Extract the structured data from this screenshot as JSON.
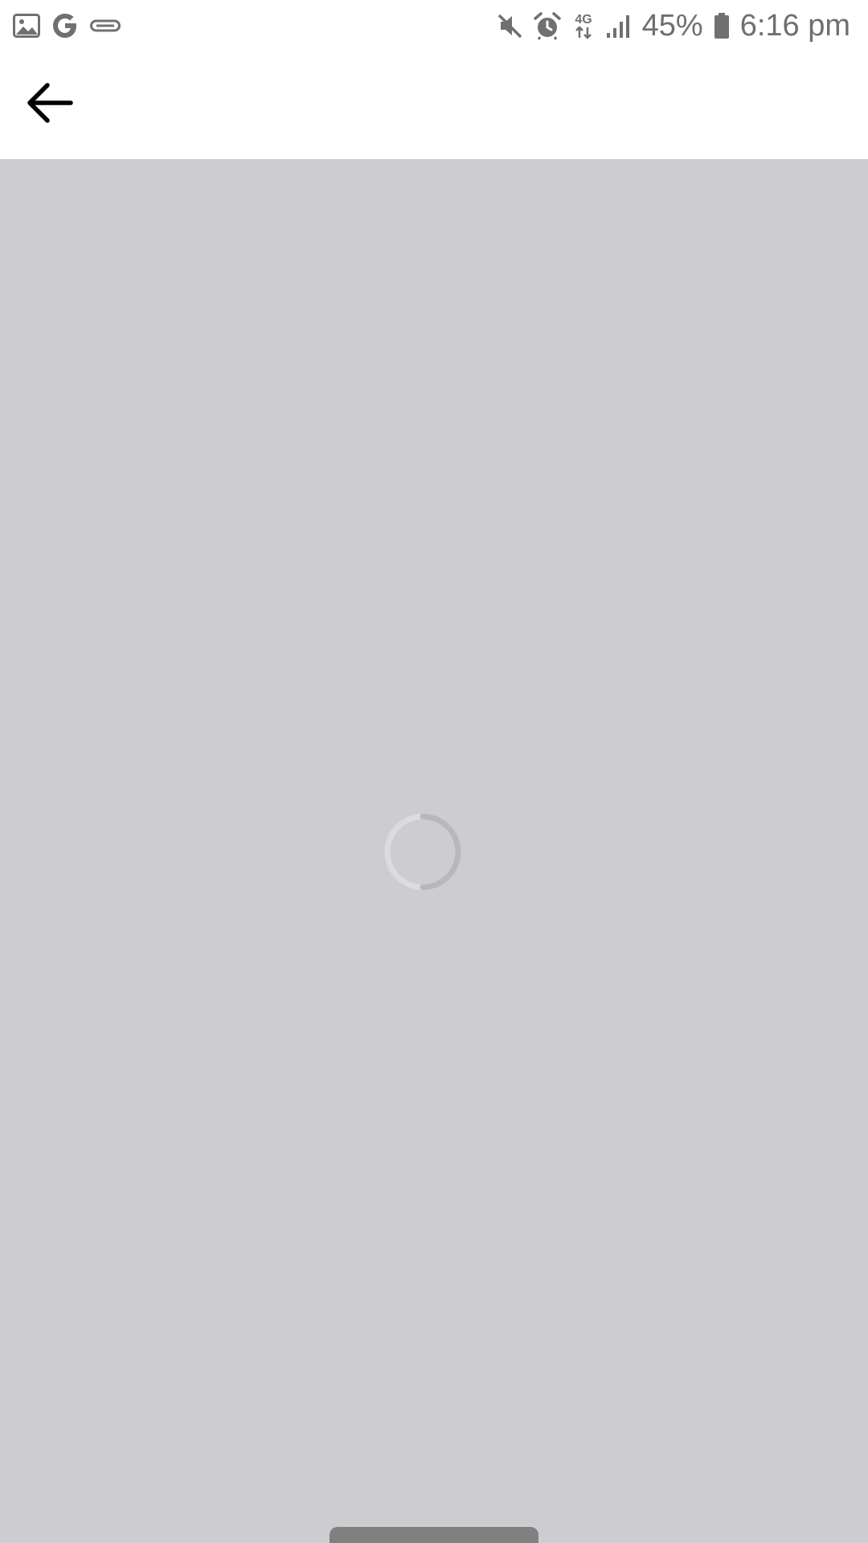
{
  "status_bar": {
    "battery_percent": "45%",
    "time": "6:16 pm",
    "network_type": "4G",
    "icons_left": [
      "image-icon",
      "google-icon",
      "link-icon"
    ],
    "icons_right": [
      "mute-icon",
      "alarm-icon",
      "network-4g-icon",
      "signal-icon",
      "battery-icon"
    ]
  },
  "app_bar": {
    "back_icon": "arrow-left-icon"
  },
  "content": {
    "state": "loading",
    "background_color": "#cdcdd1"
  },
  "colors": {
    "status_text": "#6f6f6f",
    "app_bar_bg": "#ffffff",
    "spinner_track": "#dcdcde",
    "spinner_arc": "#b8b8bc",
    "gesture_bar": "#808080"
  }
}
